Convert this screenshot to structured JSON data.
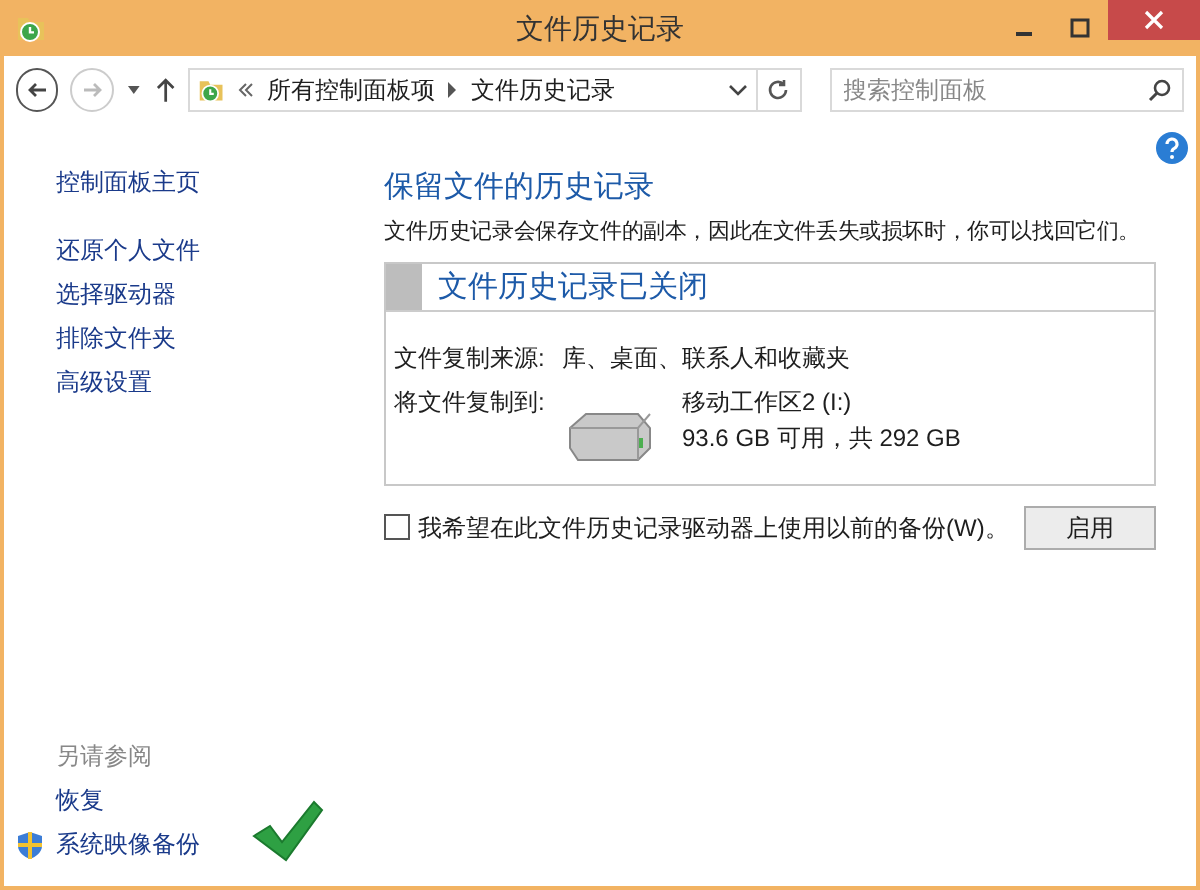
{
  "window": {
    "title": "文件历史记录"
  },
  "address": {
    "items": [
      "所有控制面板项",
      "文件历史记录"
    ]
  },
  "search": {
    "placeholder": "搜索控制面板"
  },
  "sidebar": {
    "links": [
      "控制面板主页",
      "还原个人文件",
      "选择驱动器",
      "排除文件夹",
      "高级设置"
    ],
    "see_also": {
      "heading": "另请参阅",
      "items": [
        {
          "label": "恢复",
          "kind": "plain"
        },
        {
          "label": "系统映像备份",
          "kind": "shield"
        }
      ]
    }
  },
  "main": {
    "heading": "保留文件的历史记录",
    "description": "文件历史记录会保存文件的副本，因此在文件丢失或损坏时，你可以找回它们。",
    "panel": {
      "title": "文件历史记录已关闭",
      "source_label": "文件复制来源:",
      "source_value": "库、桌面、联系人和收藏夹",
      "target_label": "将文件复制到:",
      "drive_name": "移动工作区2 (I:)",
      "drive_space": "93.6 GB 可用，共 292 GB"
    },
    "checkbox": {
      "label": "我希望在此文件历史记录驱动器上使用以前的备份(W)。",
      "checked": false
    },
    "button": "启用"
  }
}
